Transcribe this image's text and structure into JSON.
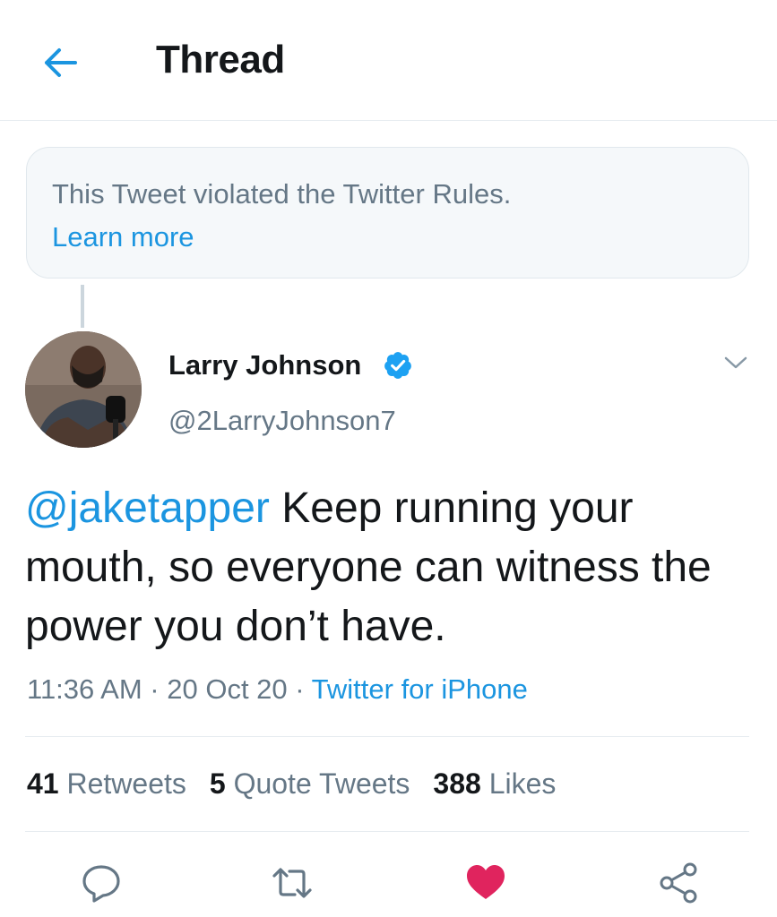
{
  "header": {
    "title": "Thread",
    "back_icon": "arrow-left-icon"
  },
  "notice": {
    "text": "This Tweet violated the Twitter Rules.",
    "link": "Learn more"
  },
  "tweet": {
    "display_name": "Larry Johnson",
    "verified": true,
    "handle": "@2LarryJohnson7",
    "mention": "@jaketapper",
    "body": " Keep running your mouth, so everyone can witness the power you don’t have.",
    "time": "11:36 AM",
    "separator": " · ",
    "date": "20 Oct 20",
    "source": "Twitter for iPhone"
  },
  "stats": {
    "retweets_count": "41",
    "retweets_label": "Retweets",
    "quotes_count": "5",
    "quotes_label": "Quote Tweets",
    "likes_count": "388",
    "likes_label": "Likes"
  },
  "actions": {
    "icons": [
      "reply-icon",
      "retweet-icon",
      "like-icon",
      "share-icon"
    ],
    "liked": true
  },
  "colors": {
    "accent": "#1b95e0",
    "like": "#e0245e",
    "muted": "#657786",
    "verified": "#1da1f2"
  }
}
